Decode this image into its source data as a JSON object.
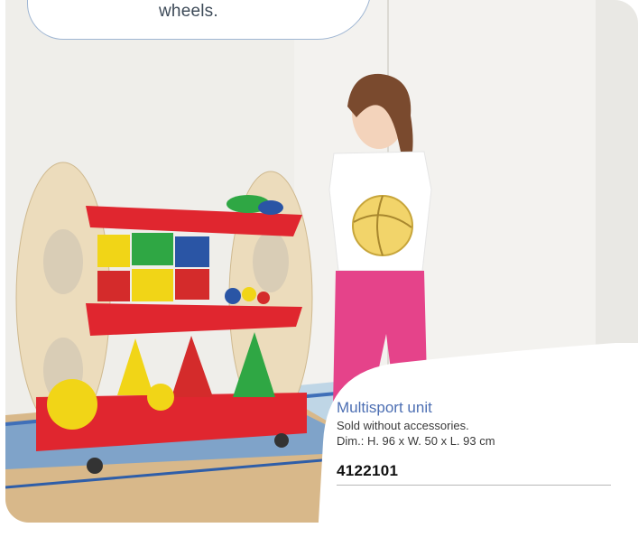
{
  "bubble": {
    "text": "wheels."
  },
  "product": {
    "title": "Multisport unit",
    "note": "Sold without accessories.",
    "dimensions": "Dim.: H. 96 x W. 50 x L. 93 cm",
    "code": "4122101"
  },
  "colors": {
    "title_blue": "#4d6fb3",
    "shelf_red": "#e0262f",
    "floor_blue": "#2f5ea8"
  }
}
